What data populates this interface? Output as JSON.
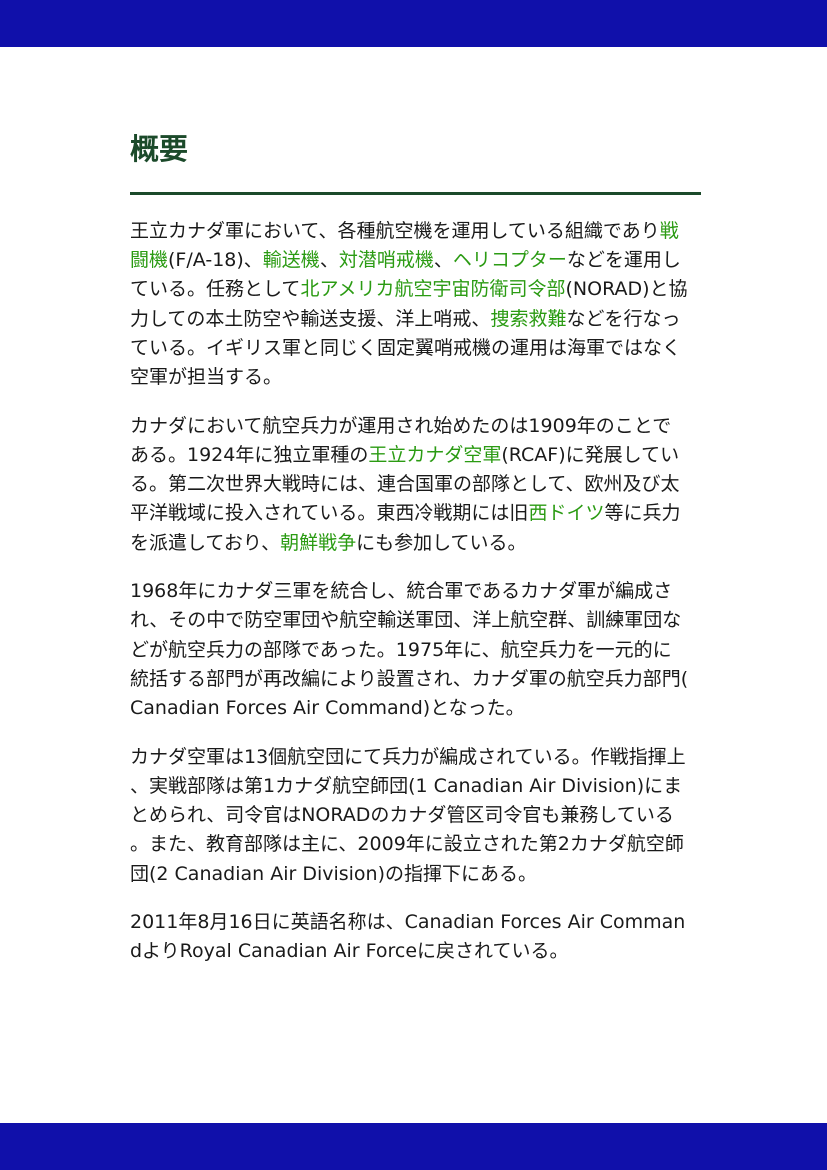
{
  "colors": {
    "bar": "#1010aa",
    "heading": "#1b4a2a",
    "rule": "#1b4a2a",
    "text": "#1a1a1a",
    "link": "#2b9b13"
  },
  "heading": "概要",
  "paragraphs": [
    {
      "runs": [
        {
          "text": "王立カナダ軍において、各種航空機を運用している組織であり"
        },
        {
          "text": "戦闘機",
          "link": true
        },
        {
          "text": "(F/A-18)、"
        },
        {
          "text": "輸送機",
          "link": true
        },
        {
          "text": "、"
        },
        {
          "text": "対潜哨戒機",
          "link": true
        },
        {
          "text": "、"
        },
        {
          "text": "ヘリコプター",
          "link": true
        },
        {
          "text": "などを運用している。任務として"
        },
        {
          "text": "北アメリカ航空宇宙防衛司令部",
          "link": true
        },
        {
          "text": "(NORAD)と協力しての本土防空や輸送支援、洋上哨戒、"
        },
        {
          "text": "捜索救難",
          "link": true
        },
        {
          "text": "などを行なっている。イギリス軍と同じく固定翼哨戒機の運用は海軍ではなく空軍が担当する。"
        }
      ]
    },
    {
      "runs": [
        {
          "text": "カナダにおいて航空兵力が運用され始めたのは1909年のことである。1924年に独立軍種の"
        },
        {
          "text": "王立カナダ空軍",
          "link": true
        },
        {
          "text": "(RCAF)に発展している。第二次世界大戦時には、連合国軍の部隊として、欧州及び太平洋戦域に投入されている。東西冷戦期には旧"
        },
        {
          "text": "西ドイツ",
          "link": true
        },
        {
          "text": "等に兵力を派遣しており、"
        },
        {
          "text": "朝鮮戦争",
          "link": true
        },
        {
          "text": "にも参加している。"
        }
      ]
    },
    {
      "runs": [
        {
          "text": "1968年にカナダ三軍を統合し、統合軍であるカナダ軍が編成され、その中で防空軍団や航空輸送軍団、洋上航空群、訓練軍団などが航空兵力の部隊であった。1975年に、航空兵力を一元的に統括する部門が再改編により設置され、カナダ軍の航空兵力部門(Canadian Forces Air Command)となった。"
        }
      ]
    },
    {
      "runs": [
        {
          "text": "カナダ空軍は13個航空団にて兵力が編成されている。作戦指揮上、実戦部隊は第1カナダ航空師団(1 Canadian Air Division)にまとめられ、司令官はNORADのカナダ管区司令官も兼務している。また、教育部隊は主に、2009年に設立された第2カナダ航空師団(2 Canadian Air Division)の指揮下にある。"
        }
      ]
    },
    {
      "runs": [
        {
          "text": "2011年8月16日に英語名称は、Canadian Forces Air CommandよりRoyal Canadian Air Forceに戻されている。"
        }
      ]
    }
  ]
}
